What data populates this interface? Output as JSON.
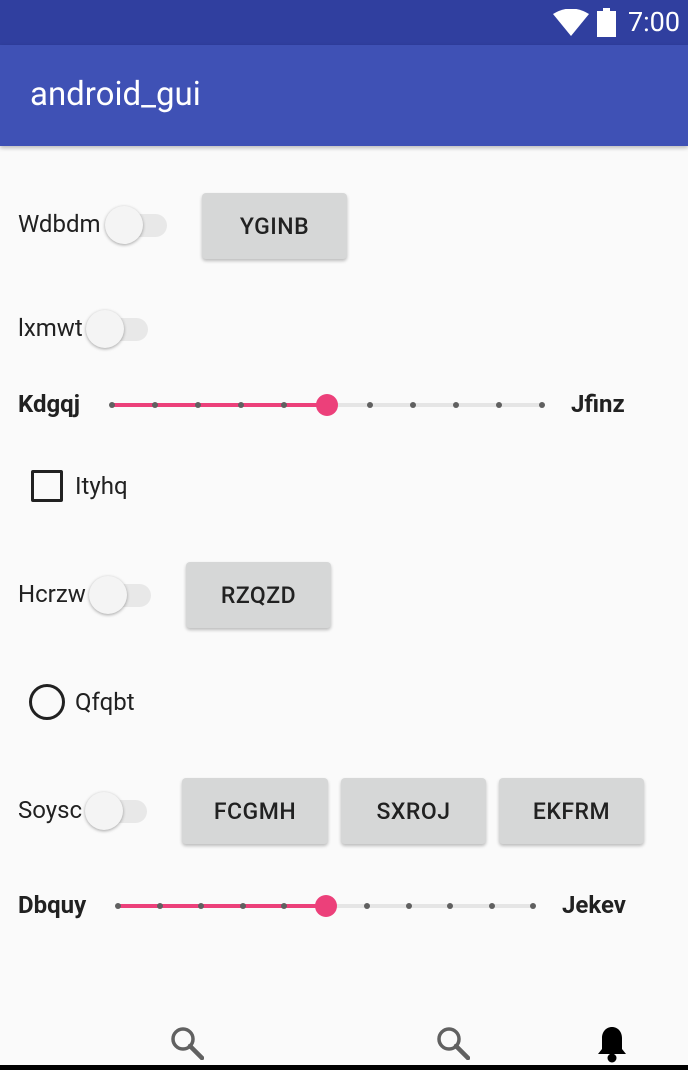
{
  "status_bar": {
    "time": "7:00",
    "icons": [
      "wifi-icon",
      "battery-icon"
    ]
  },
  "app_bar": {
    "title": "android_gui"
  },
  "rows": {
    "row1": {
      "switch_label": "Wdbdm",
      "switch_on": false,
      "button": "YGINB"
    },
    "row2": {
      "switch_label": "lxmwt",
      "switch_on": false
    },
    "row3": {
      "label_left": "Kdgqj",
      "label_right": "Jfinz",
      "slider_value": 5,
      "slider_max": 10
    },
    "row4": {
      "checkbox_label": "Ityhq",
      "checked": false
    },
    "row5": {
      "switch_label": "Hcrzw",
      "switch_on": false,
      "button": "RZQZD"
    },
    "row6": {
      "radio_label": "Qfqbt",
      "selected": false
    },
    "row7": {
      "switch_label": "Soysc",
      "switch_on": false,
      "buttons": [
        "FCGMH",
        "SXROJ",
        "EKFRM"
      ]
    },
    "row8": {
      "label_left": "Dbquy",
      "label_right": "Jekev",
      "slider_value": 5,
      "slider_max": 10
    }
  },
  "bottom_nav": {
    "icons": [
      "search-icon",
      "search-icon",
      "notifications-icon"
    ]
  },
  "colors": {
    "primary": "#3f51b5",
    "primary_dark": "#303f9f",
    "accent": "#ec407a",
    "background": "#fafafa",
    "button": "#d6d7d7"
  }
}
